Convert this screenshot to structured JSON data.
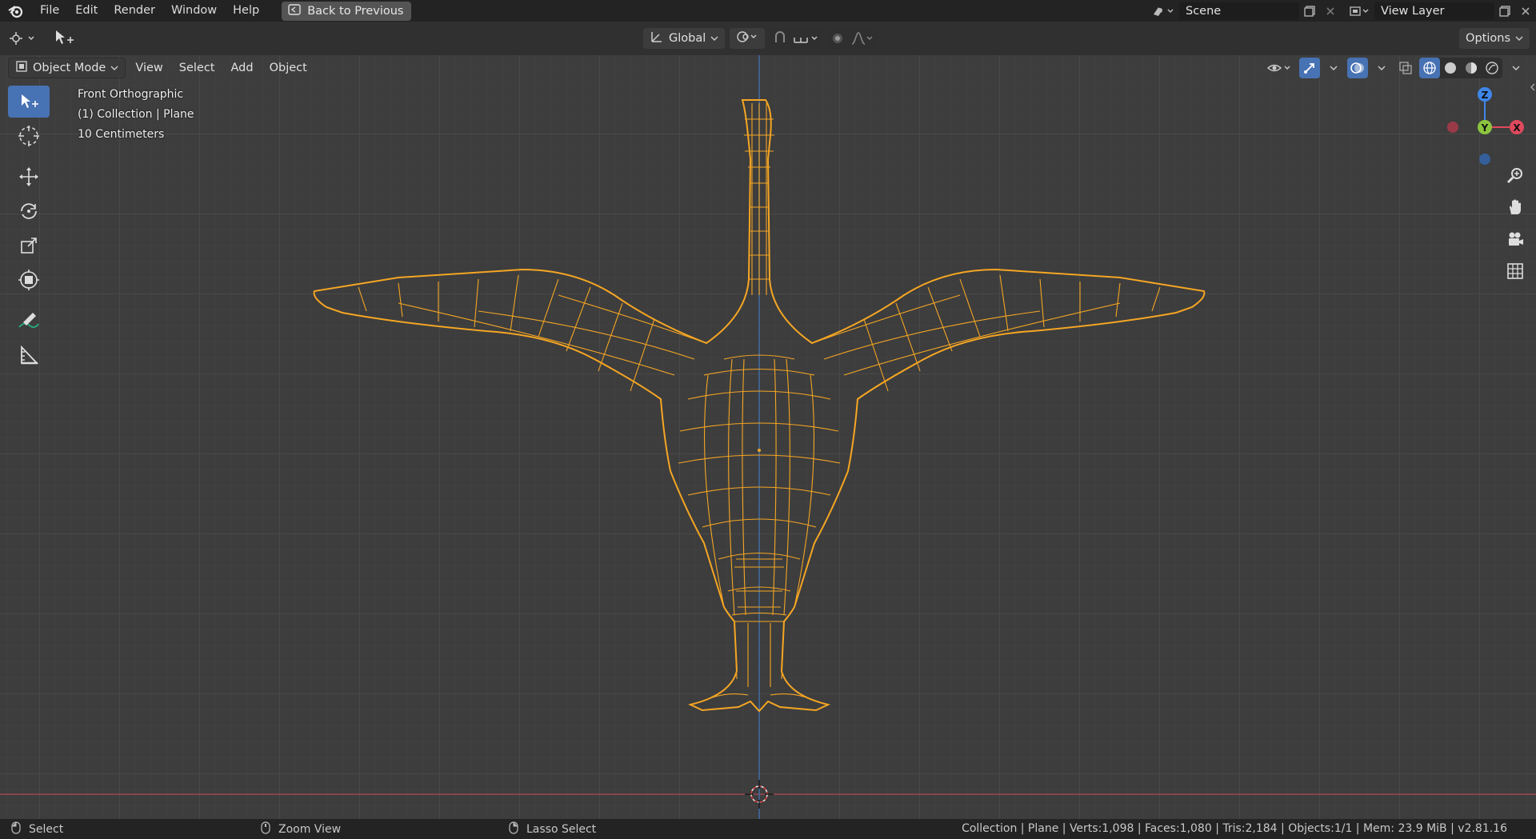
{
  "menu": {
    "items": [
      "File",
      "Edit",
      "Render",
      "Window",
      "Help"
    ],
    "back_button": "Back to Previous"
  },
  "scene": {
    "name": "Scene",
    "view_layer": "View Layer"
  },
  "toolbar": {
    "orientation": "Global",
    "options_label": "Options"
  },
  "viewport_header": {
    "mode": "Object Mode",
    "menus": [
      "View",
      "Select",
      "Add",
      "Object"
    ]
  },
  "overlay_info": {
    "view_name": "Front Orthographic",
    "collection": "(1) Collection | Plane",
    "scale": "10 Centimeters"
  },
  "gizmo": {
    "z": "Z",
    "y": "Y",
    "x": "X"
  },
  "statusbar": {
    "select": "Select",
    "zoom": "Zoom View",
    "lasso": "Lasso Select",
    "stats": "Collection | Plane | Verts:1,098 | Faces:1,080 | Tris:2,184 | Objects:1/1 | Mem: 23.9 MiB | v2.81.16"
  },
  "colors": {
    "accent": "#4772b3",
    "wire_selected": "#f5a623",
    "axis_x": "#e0495c",
    "axis_y": "#8bc53f",
    "axis_z": "#3e86e8"
  }
}
